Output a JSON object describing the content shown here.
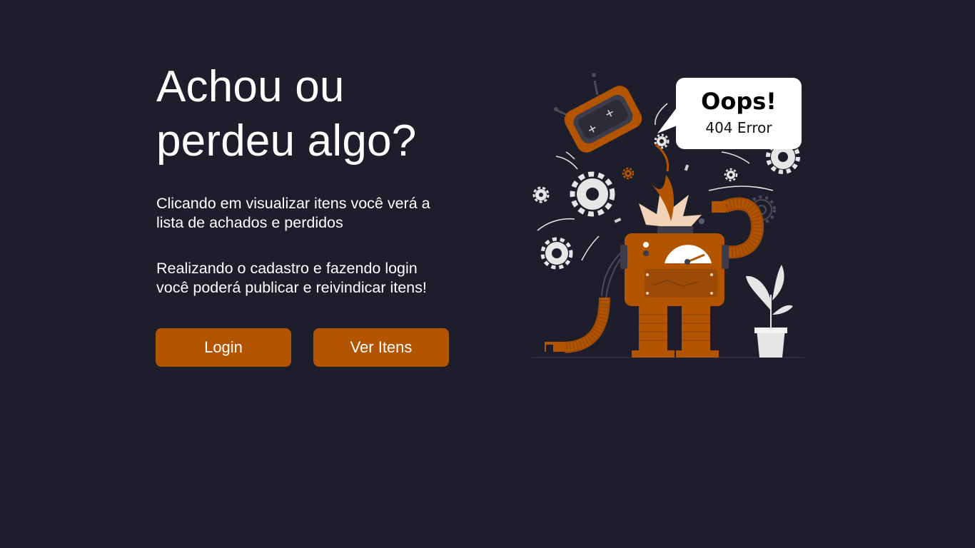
{
  "hero": {
    "title_line1": "Achou ou",
    "title_line2": "perdeu algo?",
    "description1_line1": "Clicando em visualizar itens você verá a",
    "description1_line2": "lista de achados e perdidos",
    "description2_line1": "Realizando o cadastro e fazendo login",
    "description2_line2": "você poderá publicar e reivindicar itens!"
  },
  "buttons": {
    "login_label": "Login",
    "items_label": "Ver Itens"
  },
  "illustration": {
    "bubble_title": "Oops!",
    "bubble_subtitle": "404 Error"
  },
  "colors": {
    "background": "#1e1d2b",
    "accent": "#b35500",
    "text": "#ffffff"
  }
}
